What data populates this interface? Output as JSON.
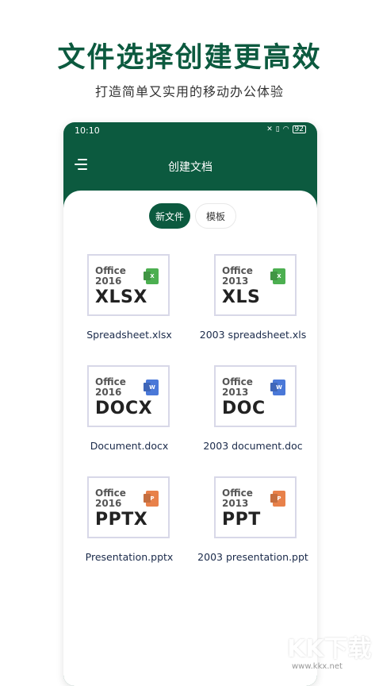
{
  "promo": {
    "title": "文件选择创建更高效",
    "subtitle": "打造简单又实用的移动办公体验"
  },
  "status_bar": {
    "time": "10:10",
    "icons": [
      "mute-icon",
      "alarm-icon",
      "wifi-icon",
      "battery-icon"
    ],
    "battery": "92"
  },
  "app_bar": {
    "title": "创建文档",
    "menu_icon": "menu-icon"
  },
  "tabs": [
    {
      "label": "新文件",
      "active": true
    },
    {
      "label": "模板",
      "active": false
    }
  ],
  "files": [
    {
      "office": "Office",
      "year": "2016",
      "ext": "XLSX",
      "icon_letter": "X",
      "icon_color": "#4caf50",
      "name": "Spreadsheet.xlsx"
    },
    {
      "office": "Office",
      "year": "2013",
      "ext": "XLS",
      "icon_letter": "X",
      "icon_color": "#4caf50",
      "name": "2003  spreadsheet.xls"
    },
    {
      "office": "Office",
      "year": "2016",
      "ext": "DOCX",
      "icon_letter": "W",
      "icon_color": "#4a78d8",
      "name": "Document.docx"
    },
    {
      "office": "Office",
      "year": "2013",
      "ext": "DOC",
      "icon_letter": "W",
      "icon_color": "#4a78d8",
      "name": "2003  document.doc"
    },
    {
      "office": "Office",
      "year": "2016",
      "ext": "PPTX",
      "icon_letter": "P",
      "icon_color": "#e8814a",
      "name": "Presentation.pptx"
    },
    {
      "office": "Office",
      "year": "2013",
      "ext": "PPT",
      "icon_letter": "P",
      "icon_color": "#e8814a",
      "name": "2003  presentation.ppt"
    }
  ],
  "colors": {
    "brand": "#0c5a3f"
  },
  "watermark": {
    "logo": "KK下载",
    "url": "www.kkx.net"
  }
}
